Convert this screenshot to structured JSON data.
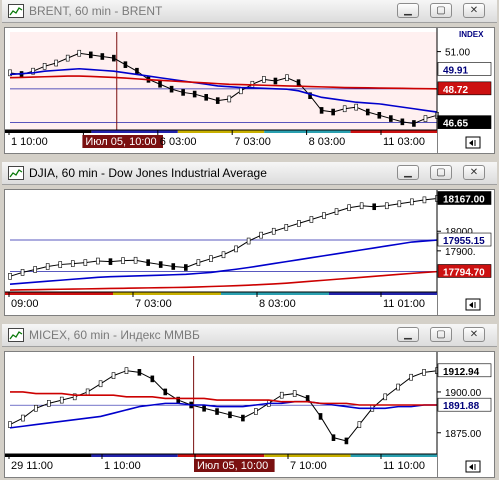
{
  "windows": [
    {
      "title": "BRENT, 60 min - BRENT",
      "active": false,
      "chart_data": {
        "type": "line",
        "title": "BRENT, 60 min - BRENT",
        "price_axis_label": "INDEX",
        "ylim": [
          46.2,
          52.2
        ],
        "ticks": [
          {
            "value": 51.0,
            "label": "51.00"
          }
        ],
        "price_markers": [
          {
            "value": 49.91,
            "label": "49.91",
            "bg": "#ffffff",
            "fg": "#00007a"
          },
          {
            "value": 48.72,
            "label": "48.72",
            "bg": "#cc1111",
            "fg": "#ffffff"
          },
          {
            "value": 46.65,
            "label": "46.65",
            "bg": "#000000",
            "fg": "#ffffff"
          }
        ],
        "time_labels": [
          "1 10:00",
          "Июл 05, 10:00",
          "6 03:00",
          "7 03:00",
          "8 03:00",
          "11 03:00"
        ],
        "highlight_time_label": "Июл 05, 10:00",
        "series": [
          {
            "name": "price",
            "color": "#000000",
            "values": [
              49.7,
              49.6,
              49.8,
              50.1,
              50.3,
              50.6,
              50.9,
              50.8,
              50.7,
              50.6,
              50.2,
              49.8,
              49.3,
              49.0,
              48.7,
              48.5,
              48.4,
              48.2,
              48.0,
              48.1,
              48.6,
              49.0,
              49.3,
              49.2,
              49.4,
              49.1,
              48.3,
              47.4,
              47.3,
              47.5,
              47.6,
              47.3,
              47.1,
              46.9,
              46.7,
              46.6,
              46.9,
              47.1
            ]
          },
          {
            "name": "moving average",
            "color": "#0000cc",
            "values": [
              49.6,
              49.65,
              49.7,
              49.8,
              49.85,
              49.9,
              49.95,
              49.9,
              49.85,
              49.8,
              49.7,
              49.6,
              49.5,
              49.4,
              49.3,
              49.2,
              49.1,
              49.0,
              48.9,
              48.85,
              48.8,
              48.78,
              48.75,
              48.72,
              48.7,
              48.6,
              48.4,
              48.2,
              48.1,
              48.0,
              47.9,
              47.85,
              47.8,
              47.7,
              47.6,
              47.5,
              47.4,
              47.3
            ]
          },
          {
            "name": "moving average 2",
            "color": "#cc0000",
            "values": [
              49.4,
              49.42,
              49.44,
              49.46,
              49.48,
              49.5,
              49.5,
              49.48,
              49.45,
              49.42,
              49.38,
              49.33,
              49.28,
              49.24,
              49.2,
              49.16,
              49.12,
              49.08,
              49.04,
              49.0,
              48.98,
              48.96,
              48.94,
              48.92,
              48.9,
              48.88,
              48.86,
              48.84,
              48.82,
              48.8,
              48.79,
              48.78,
              48.77,
              48.76,
              48.75,
              48.74,
              48.73,
              48.72
            ]
          }
        ]
      }
    },
    {
      "title": "DJIA, 60 min - Dow Jones Industrial Average",
      "active": true,
      "chart_data": {
        "type": "line",
        "title": "DJIA, 60 min - Dow Jones Industrial Average",
        "price_axis_label": "INDEX",
        "ylim": [
          17690,
          18190
        ],
        "ticks": [
          {
            "value": 18000,
            "label": "18000."
          },
          {
            "value": 17900,
            "label": "17900."
          }
        ],
        "price_markers": [
          {
            "value": 18167.0,
            "label": "18167.00",
            "bg": "#000000",
            "fg": "#ffffff"
          },
          {
            "value": 17955.15,
            "label": "17955.15",
            "bg": "#ffffff",
            "fg": "#00007a"
          },
          {
            "value": 17794.7,
            "label": "17794.70",
            "bg": "#cc1111",
            "fg": "#ffffff"
          }
        ],
        "time_labels": [
          "09:00",
          "7 03:00",
          "8 03:00",
          "11 01:00"
        ],
        "highlight_time_label": "",
        "series": [
          {
            "name": "price",
            "color": "#000000",
            "values": [
              17770,
              17790,
              17805,
              17820,
              17830,
              17835,
              17840,
              17848,
              17845,
              17850,
              17852,
              17840,
              17830,
              17820,
              17815,
              17840,
              17860,
              17880,
              17910,
              17950,
              17980,
              18000,
              18020,
              18040,
              18060,
              18080,
              18100,
              18120,
              18130,
              18125,
              18130,
              18140,
              18150,
              18160,
              18167
            ]
          },
          {
            "name": "moving average",
            "color": "#0000cc",
            "values": [
              17730,
              17735,
              17740,
              17745,
              17750,
              17755,
              17760,
              17765,
              17768,
              17770,
              17772,
              17774,
              17776,
              17778,
              17780,
              17785,
              17790,
              17798,
              17806,
              17815,
              17825,
              17835,
              17845,
              17855,
              17865,
              17875,
              17885,
              17895,
              17905,
              17915,
              17925,
              17935,
              17945,
              17950,
              17955
            ]
          },
          {
            "name": "moving average 2",
            "color": "#cc0000",
            "values": [
              17700,
              17701,
              17702,
              17703,
              17704,
              17705,
              17706,
              17707,
              17708,
              17709,
              17710,
              17711,
              17712,
              17713,
              17714,
              17716,
              17718,
              17720,
              17722,
              17725,
              17728,
              17731,
              17735,
              17740,
              17745,
              17750,
              17755,
              17760,
              17765,
              17770,
              17775,
              17780,
              17785,
              17790,
              17794
            ]
          }
        ]
      }
    },
    {
      "title": "MICEX, 60 min - Индекс ММВБ",
      "active": false,
      "chart_data": {
        "type": "line",
        "title": "MICEX, 60 min - Индекс ММВБ",
        "price_axis_label": "",
        "ylim": [
          1862,
          1922
        ],
        "ticks": [
          {
            "value": 1900,
            "label": "1900.00"
          },
          {
            "value": 1875,
            "label": "1875.00"
          }
        ],
        "price_markers": [
          {
            "value": 1912.94,
            "label": "1912.94",
            "bg": "#ffffff",
            "fg": "#000000"
          },
          {
            "value": 1891.88,
            "label": "1891.88",
            "bg": "#ffffff",
            "fg": "#00007a"
          }
        ],
        "time_labels": [
          "29 11:00",
          "1 10:00",
          "Июл 05, 10:00",
          "7 10:00",
          "11 10:00"
        ],
        "highlight_time_label": "Июл 05, 10:00",
        "series": [
          {
            "name": "price",
            "color": "#000000",
            "values": [
              1880,
              1884,
              1890,
              1893,
              1895,
              1897,
              1900,
              1905,
              1910,
              1913,
              1912,
              1908,
              1900,
              1895,
              1892,
              1890,
              1888,
              1886,
              1884,
              1888,
              1893,
              1898,
              1899,
              1896,
              1885,
              1872,
              1870,
              1880,
              1890,
              1897,
              1903,
              1909,
              1912,
              1913
            ]
          },
          {
            "name": "moving average",
            "color": "#0000cc",
            "values": [
              1878,
              1879,
              1880,
              1881,
              1882,
              1883,
              1884,
              1885,
              1887,
              1889,
              1891,
              1892,
              1893,
              1893,
              1892,
              1892,
              1891,
              1891,
              1891,
              1892,
              1893,
              1893,
              1894,
              1894,
              1893,
              1892,
              1891,
              1890,
              1890,
              1890,
              1891,
              1891,
              1892,
              1892
            ]
          },
          {
            "name": "moving average 2",
            "color": "#cc0000",
            "values": [
              1900,
              1900,
              1899,
              1899,
              1899,
              1898,
              1898,
              1898,
              1898,
              1897,
              1897,
              1897,
              1896,
              1896,
              1896,
              1896,
              1895,
              1895,
              1895,
              1895,
              1895,
              1894,
              1894,
              1894,
              1893,
              1893,
              1893,
              1892,
              1892,
              1892,
              1892,
              1892,
              1892,
              1892
            ]
          }
        ]
      }
    }
  ]
}
